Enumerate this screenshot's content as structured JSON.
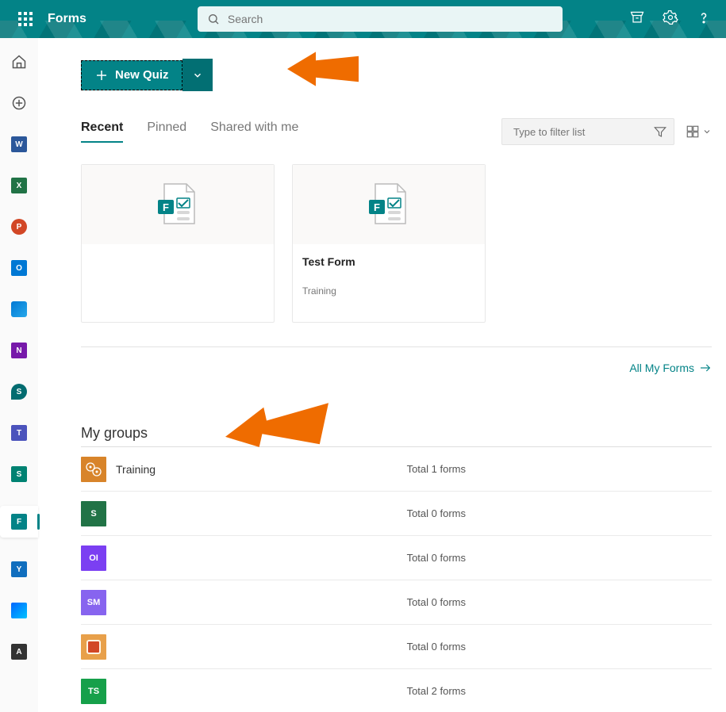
{
  "header": {
    "app_title": "Forms",
    "search_placeholder": "Search"
  },
  "rail": [
    {
      "type": "home"
    },
    {
      "type": "create"
    },
    {
      "type": "app",
      "cls": "icon-word",
      "txt": "W"
    },
    {
      "type": "app",
      "cls": "icon-excel",
      "txt": "X"
    },
    {
      "type": "app",
      "cls": "icon-ppt",
      "txt": "P"
    },
    {
      "type": "app",
      "cls": "icon-outlook",
      "txt": "O"
    },
    {
      "type": "app",
      "cls": "icon-onedrive",
      "txt": ""
    },
    {
      "type": "app",
      "cls": "icon-onenote",
      "txt": "N"
    },
    {
      "type": "app",
      "cls": "icon-sp",
      "txt": "S"
    },
    {
      "type": "app",
      "cls": "icon-teams",
      "txt": "T"
    },
    {
      "type": "app",
      "cls": "icon-sway",
      "txt": "S"
    },
    {
      "type": "app",
      "cls": "icon-forms",
      "txt": "F",
      "active": true
    },
    {
      "type": "app",
      "cls": "icon-yammer",
      "txt": "Y"
    },
    {
      "type": "app",
      "cls": "icon-pa",
      "txt": ""
    },
    {
      "type": "app",
      "cls": "icon-admin",
      "txt": "A"
    }
  ],
  "new_button": {
    "label": "New Quiz"
  },
  "tabs": [
    {
      "label": "Recent",
      "active": true
    },
    {
      "label": "Pinned",
      "active": false
    },
    {
      "label": "Shared with me",
      "active": false
    }
  ],
  "filter_placeholder": "Type to filter list",
  "cards": [
    {
      "title": "",
      "sub": "",
      "blank": true
    },
    {
      "title": "Test Form",
      "sub": "Training",
      "blank": false
    }
  ],
  "all_forms_label": "All My Forms",
  "groups_heading": "My groups",
  "groups": [
    {
      "name": "Training",
      "icon_bg": "#d8842a",
      "icon_txt": "",
      "icon_gear": true,
      "total": "Total 1 forms"
    },
    {
      "name": "",
      "icon_bg": "#217346",
      "icon_txt": "S",
      "total": "Total 0 forms"
    },
    {
      "name": "",
      "icon_bg": "#7b3ff2",
      "icon_txt": "OI",
      "total": "Total 0 forms"
    },
    {
      "name": "",
      "icon_bg": "#8764ef",
      "icon_txt": "SM",
      "total": "Total 0 forms"
    },
    {
      "name": "",
      "icon_bg": "#e8a04a",
      "icon_sq": true,
      "icon_txt": "",
      "total": "Total 0 forms"
    },
    {
      "name": "",
      "icon_bg": "#16a04a",
      "icon_txt": "TS",
      "total": "Total 2 forms"
    }
  ],
  "colors": {
    "accent": "#038387",
    "arrow": "#ef6c00"
  }
}
